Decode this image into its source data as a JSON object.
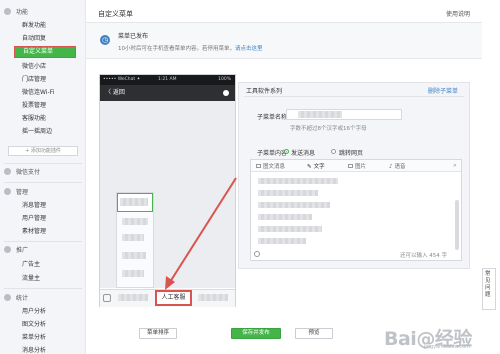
{
  "sidebar": {
    "sections": [
      {
        "title": "功能",
        "items": [
          "群发功能",
          "自动回复",
          "自定义菜单",
          "微信小店",
          "门店管理",
          "微信连Wi-Fi",
          "投票管理",
          "客服功能",
          "摇一摇周边"
        ]
      },
      {
        "title": "微信支付",
        "items": []
      },
      {
        "title": "管理",
        "items": [
          "消息管理",
          "用户管理",
          "素材管理"
        ]
      },
      {
        "title": "推广",
        "items": [
          "广告主",
          "流量主"
        ]
      },
      {
        "title": "统计",
        "items": [
          "用户分析",
          "图文分析",
          "菜单分析",
          "消息分析"
        ]
      }
    ],
    "add_plugin": "+ 添加功能插件"
  },
  "header": {
    "title": "自定义菜单",
    "help": "使用说明"
  },
  "notice": {
    "title": "菜单已发布",
    "desc": "10小时后可在手机查看菜单内容。若停用菜单，",
    "link": "请点击这里"
  },
  "phone": {
    "carrier": "••••• WeChat ✦",
    "time": "1:21 AM",
    "battery": "100%",
    "back": "〈 返回",
    "menu_item": "人工客服"
  },
  "editor": {
    "title": "工具软件系列",
    "delete": "删除子菜单",
    "name_label": "子菜单名称",
    "name_tip": "字数不超过8个汉字或16个字母",
    "content_label": "子菜单内容",
    "radio_send": "发送消息",
    "radio_jump": "跳转网页",
    "tabs": [
      "图文消息",
      "文字",
      "图片",
      "语音"
    ],
    "more": "»",
    "char_count": "还可以输入 454 字"
  },
  "buttons": {
    "sort": "菜单排序",
    "save": "保存并发布",
    "preview": "预览"
  },
  "faq": "常见问题",
  "watermark": {
    "main": "Bai@经验",
    "sub": "jingyan.baidu.com"
  },
  "colors": {
    "accent": "#44b549",
    "link": "#3e82c5",
    "highlight": "#d9534f"
  }
}
